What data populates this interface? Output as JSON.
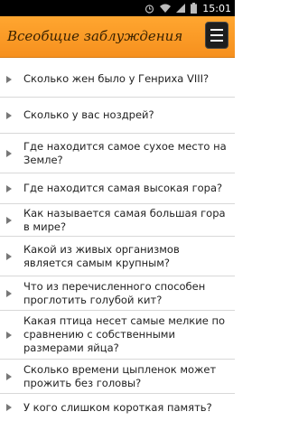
{
  "status_bar": {
    "time": "15:01",
    "icons": [
      "alarm-icon",
      "wifi-icon",
      "signal-icon",
      "battery-icon"
    ]
  },
  "app_bar": {
    "title": "Всеобщие заблуждения",
    "menu_icon": "menu-icon",
    "accent": "#f6901e"
  },
  "questions": [
    {
      "text": "Сколько жен было у Генриха VIII?"
    },
    {
      "text": "Сколько у вас ноздрей?"
    },
    {
      "text": "Где находится самое сухое место на Земле?"
    },
    {
      "text": "Где находится самая высокая гора?"
    },
    {
      "text": "Как называется самая большая гора в мире?"
    },
    {
      "text": "Какой из живых организмов является самым крупным?"
    },
    {
      "text": "Что из перечисленного способен проглотить голубой кит?"
    },
    {
      "text": "Какая птица несет самые мелкие по сравнению с собственными размерами яйца?"
    },
    {
      "text": "Сколько времени цыпленок может прожить без головы?"
    },
    {
      "text": "У кого слишком короткая память?"
    }
  ]
}
